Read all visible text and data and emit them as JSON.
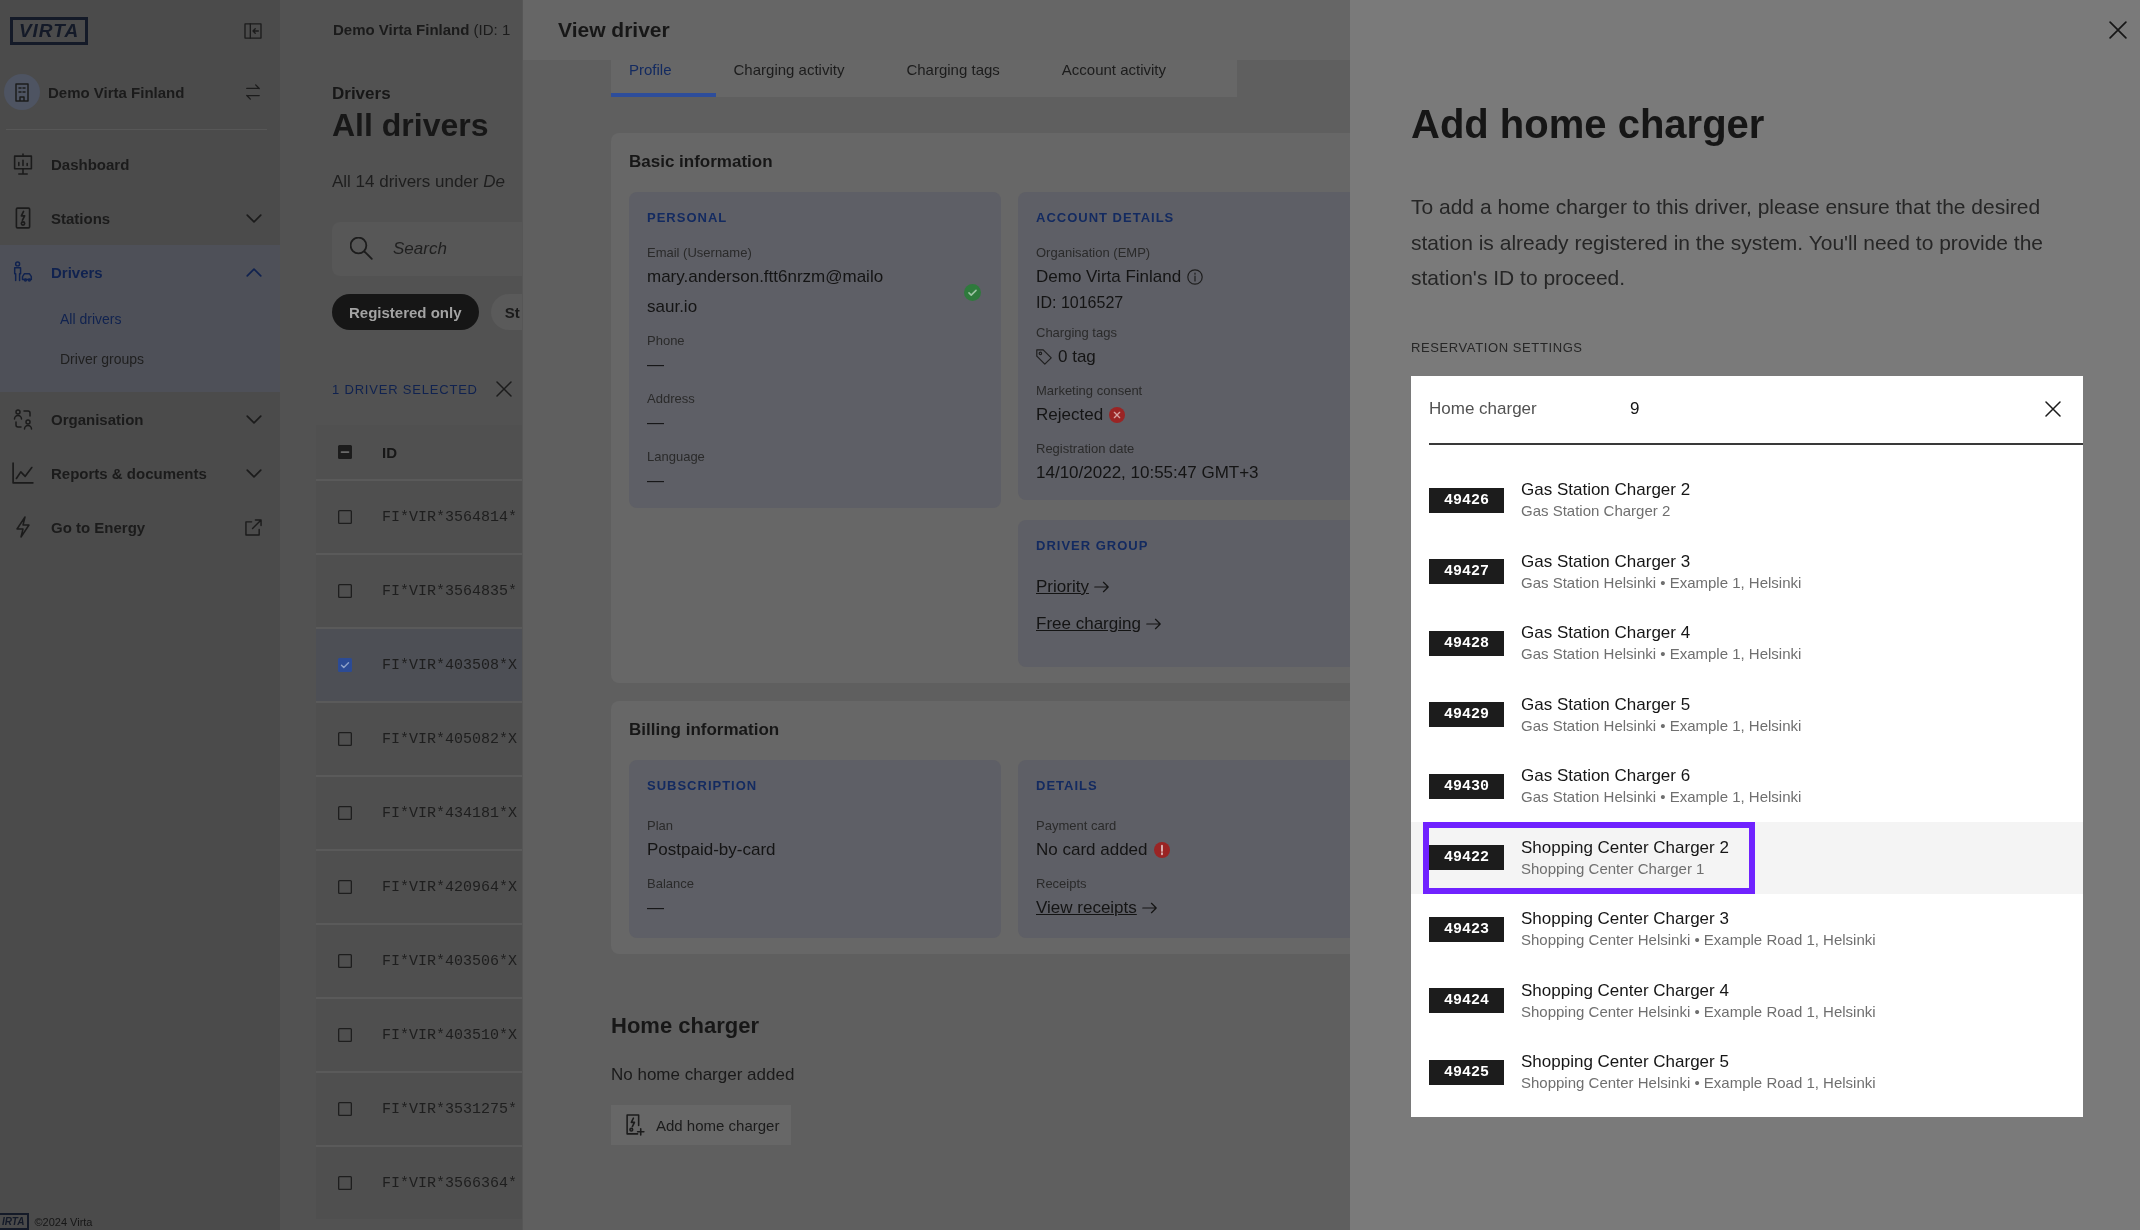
{
  "sidebar": {
    "logo": "VIRTA",
    "organisation": "Demo Virta Finland",
    "nav": [
      {
        "label": "Dashboard",
        "kind": "link",
        "selected": false
      },
      {
        "label": "Stations",
        "kind": "group",
        "selected": false,
        "expanded": false
      },
      {
        "label": "Drivers",
        "kind": "group",
        "selected": true,
        "expanded": true,
        "children": [
          {
            "label": "All drivers",
            "selected": true
          },
          {
            "label": "Driver groups",
            "selected": false
          }
        ]
      },
      {
        "label": "Organisation",
        "kind": "group",
        "selected": false,
        "expanded": false
      },
      {
        "label": "Reports & documents",
        "kind": "group",
        "selected": false,
        "expanded": false
      },
      {
        "label": "Go to Energy",
        "kind": "external",
        "selected": false
      }
    ],
    "footer": {
      "logo": "IRTA",
      "copyright": "©2024 Virta"
    }
  },
  "drivers_page": {
    "breadcrumb": "**Demo Virta Finland** (ID: 1",
    "eyebrow": "Drivers",
    "title": "All drivers",
    "summary": "All 14 drivers under *De*",
    "search": {
      "placeholder": "Search"
    },
    "filters": [
      {
        "label": "Registered only",
        "selected": true
      },
      {
        "label": "St",
        "selected": false
      }
    ],
    "selection": "1 DRIVER SELECTED",
    "table": {
      "columns": [
        "ID"
      ],
      "select_all": {
        "checked": false,
        "indeterminate": true
      },
      "rows": [
        {
          "id": "FI*VIR*3564814*",
          "checked": false
        },
        {
          "id": "FI*VIR*3564835*",
          "checked": false
        },
        {
          "id": "FI*VIR*403508*X",
          "checked": true
        },
        {
          "id": "FI*VIR*405082*X",
          "checked": false
        },
        {
          "id": "FI*VIR*434181*X",
          "checked": false
        },
        {
          "id": "FI*VIR*420964*X",
          "checked": false
        },
        {
          "id": "FI*VIR*403506*X",
          "checked": false
        },
        {
          "id": "FI*VIR*403510*X",
          "checked": false
        },
        {
          "id": "FI*VIR*3531275*",
          "checked": false
        },
        {
          "id": "FI*VIR*3566364*",
          "checked": false
        }
      ]
    }
  },
  "view_driver": {
    "title": "View driver",
    "tabs": [
      {
        "label": "Profile",
        "selected": true
      },
      {
        "label": "Charging activity",
        "selected": false
      },
      {
        "label": "Charging tags",
        "selected": false
      },
      {
        "label": "Account activity",
        "selected": false
      }
    ],
    "sections": [
      {
        "title": "Basic information",
        "panels": [
          {
            "heading": "PERSONAL",
            "fields": [
              {
                "label": "Email (Username)",
                "value": "mary.anderson.ftt6nrzm@mailosaur.io",
                "kind": "text",
                "verified": true
              },
              {
                "label": "Phone",
                "value": "—",
                "kind": "text"
              },
              {
                "label": "Address",
                "value": "—",
                "kind": "text"
              },
              {
                "label": "Language",
                "value": "—",
                "kind": "text"
              }
            ]
          },
          {
            "heading": "ACCOUNT DETAILS",
            "fields": [
              {
                "label": "Organisation (EMP)",
                "value": "Demo Virta Finland",
                "kind": "info",
                "note": "ID: 1016527"
              },
              {
                "label": "Charging tags",
                "value": "0 tag",
                "kind": "tag"
              },
              {
                "label": "Marketing consent",
                "value": "Rejected",
                "kind": "text",
                "rejected": true
              },
              {
                "label": "Registration date",
                "value": "14/10/2022, 10:55:47 GMT+3",
                "kind": "text"
              }
            ]
          },
          {
            "heading": "DRIVER GROUP",
            "fields": [
              {
                "value": "Priority",
                "kind": "link"
              },
              {
                "value": "Free charging",
                "kind": "link"
              }
            ]
          }
        ]
      },
      {
        "title": "Billing information",
        "panels": [
          {
            "heading": "SUBSCRIPTION",
            "fields": [
              {
                "label": "Plan",
                "value": "Postpaid-by-card",
                "kind": "text"
              },
              {
                "label": "Balance",
                "value": "—",
                "kind": "text"
              }
            ]
          },
          {
            "heading": "DETAILS",
            "fields": [
              {
                "label": "Payment card",
                "value": "No card added",
                "kind": "text",
                "error": true
              },
              {
                "label": "Receipts",
                "value": "View receipts",
                "kind": "link"
              }
            ]
          }
        ]
      }
    ],
    "home_charger": {
      "title": "Home charger",
      "message": "No home charger added",
      "button": "Add home charger"
    }
  },
  "add_home_charger": {
    "title": "Add home charger",
    "description": "To add a home charger to this driver, please ensure that the desired station is already registered in the system. You'll need to provide the station's ID to proceed.",
    "section_label": "RESERVATION SETTINGS",
    "combobox": {
      "label": "Home charger",
      "value": "9",
      "options": [
        {
          "id": "49426",
          "name": "Gas Station Charger 2",
          "location": "Gas Station Charger 2",
          "highlighted": false
        },
        {
          "id": "49427",
          "name": "Gas Station Charger 3",
          "location": "Gas Station Helsinki • Example 1, Helsinki",
          "highlighted": false
        },
        {
          "id": "49428",
          "name": "Gas Station Charger 4",
          "location": "Gas Station Helsinki • Example 1, Helsinki",
          "highlighted": false
        },
        {
          "id": "49429",
          "name": "Gas Station Charger 5",
          "location": "Gas Station Helsinki • Example 1, Helsinki",
          "highlighted": false
        },
        {
          "id": "49430",
          "name": "Gas Station Charger 6",
          "location": "Gas Station Helsinki • Example 1, Helsinki",
          "highlighted": false
        },
        {
          "id": "49422",
          "name": "Shopping Center Charger 2",
          "location": "Shopping Center Charger 1",
          "highlighted": true
        },
        {
          "id": "49423",
          "name": "Shopping Center Charger 3",
          "location": "Shopping Center Helsinki • Example Road 1, Helsinki",
          "highlighted": false
        },
        {
          "id": "49424",
          "name": "Shopping Center Charger 4",
          "location": "Shopping Center Helsinki • Example Road 1, Helsinki",
          "highlighted": false
        },
        {
          "id": "49425",
          "name": "Shopping Center Charger 5",
          "location": "Shopping Center Helsinki • Example Road 1, Helsinki",
          "highlighted": false
        }
      ]
    }
  }
}
